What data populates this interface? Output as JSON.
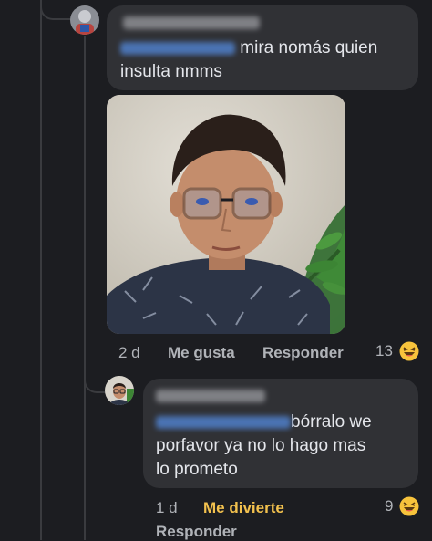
{
  "comment1": {
    "text": "mira nomás quien insulta nmms",
    "time": "2 d",
    "like_label": "Me gusta",
    "reply_label": "Responder",
    "reaction_count": "13",
    "reaction_icon": "laughing-emoji-icon"
  },
  "comment2": {
    "text_line1": "bórralo we",
    "text_line2": "porfavor ya no lo hago mas",
    "text_line3": "lo prometo",
    "time": "1 d",
    "reaction_label": "Me divierte",
    "reply_label": "Responder",
    "reaction_count": "9",
    "reaction_icon": "laughing-emoji-icon"
  },
  "colors": {
    "background": "#1c1d21",
    "bubble": "#303135",
    "text": "#e4e6eb",
    "meta": "#b0b3b8",
    "reaction_highlight": "#f2c14e",
    "mention_blur": "#4f7fc9"
  }
}
